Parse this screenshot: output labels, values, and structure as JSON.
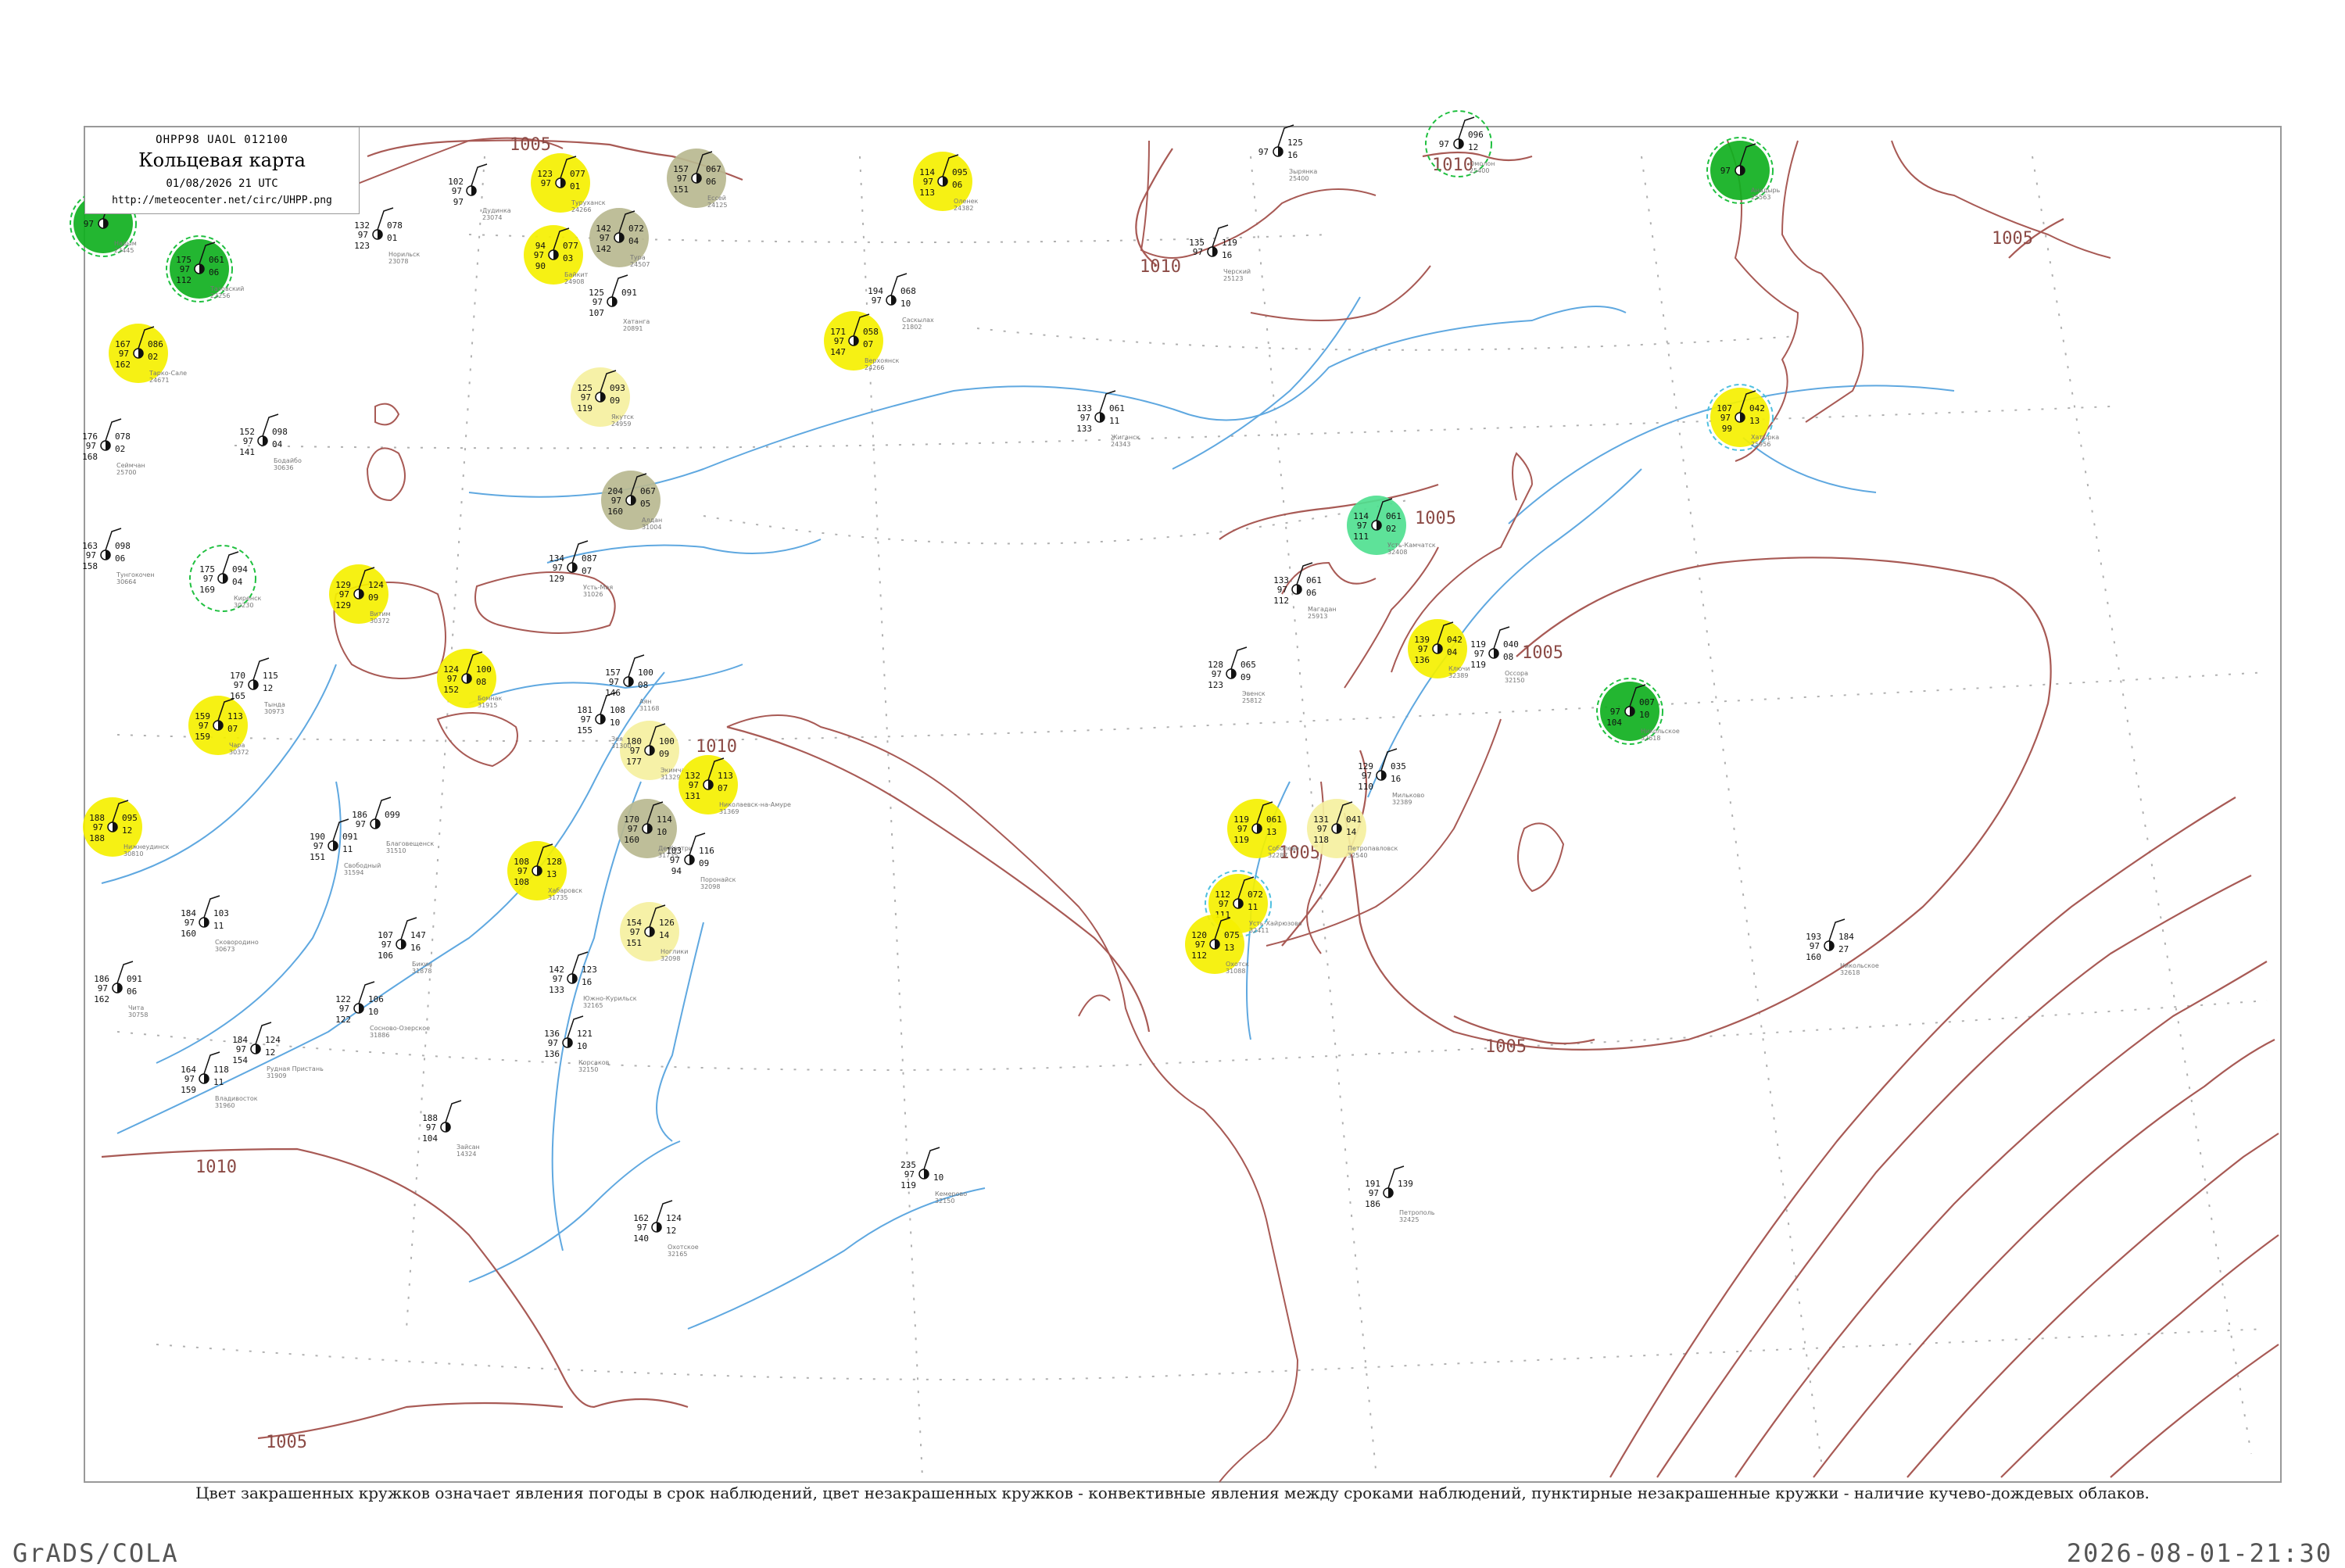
{
  "header": {
    "code": "ОНРР98 UAOL 012100",
    "title": "Кольцевая карта",
    "datetime": "01/08/2026 21 UTC",
    "url": "http://meteocenter.net/circ/UHPP.png"
  },
  "caption": "Цвет закрашенных кружков означает явления погоды в срок наблюдений, цвет незакрашенных кружков - конвективные явления между сроками наблюдений, пунктирные незакрашенные кружки - наличие кучево-дождевых облаков.",
  "footer": {
    "left": "GrADS/COLA",
    "right": "2026-08-01-21:30"
  },
  "colors": {
    "isobar": "#a85a55",
    "river": "#5fa8e0",
    "grid": "#b0b0b0",
    "rain_yellow": "#f5f000",
    "light_yellow": "#f5f0a0",
    "fog_olive": "#b8b890",
    "storm_green": "#10b020",
    "shower_teal": "#50e090",
    "cb_dash": "#20c040"
  },
  "isobar_labels": [
    "1005",
    "1010",
    "1005",
    "1010",
    "1005",
    "1005",
    "1005",
    "1005",
    "1010",
    "1010",
    "1005"
  ],
  "stations": [
    {
      "name": "Надым",
      "id": "23445",
      "tl": "",
      "tr": "",
      "bl": "",
      "br": "",
      "fill": "#10b020",
      "ring": "#20c040",
      "mx": 0.044,
      "my": 0.143
    },
    {
      "name": "Тазовский",
      "id": "23256",
      "tl": "175",
      "tr": "061",
      "bl": "112",
      "br": "06",
      "fill": "#10b020",
      "ring": "#20c040",
      "mx": 0.085,
      "my": 0.172
    },
    {
      "name": "Тарко-Сале",
      "id": "24671",
      "tl": "167",
      "tr": "086",
      "bl": "162",
      "br": "02",
      "fill": "#f5f000",
      "ring": "",
      "mx": 0.059,
      "my": 0.226
    },
    {
      "name": "Туруханск",
      "id": "24266",
      "tl": "123",
      "tr": "077",
      "bl": "",
      "br": "01",
      "fill": "#f5f000",
      "ring": "",
      "mx": 0.239,
      "my": 0.117
    },
    {
      "name": "Ессей",
      "id": "24125",
      "tl": "157",
      "tr": "067",
      "bl": "151",
      "br": "06",
      "fill": "#b8b890",
      "ring": "",
      "mx": 0.297,
      "my": 0.114
    },
    {
      "name": "Тура",
      "id": "24507",
      "tl": "142",
      "tr": "072",
      "bl": "142",
      "br": "04",
      "fill": "#b8b890",
      "ring": "",
      "mx": 0.264,
      "my": 0.152
    },
    {
      "name": "Байкит",
      "id": "24908",
      "tl": "94",
      "tr": "077",
      "bl": "90",
      "br": "03",
      "fill": "#f5f000",
      "ring": "",
      "mx": 0.236,
      "my": 0.163
    },
    {
      "name": "Оленек",
      "id": "24382",
      "tl": "114",
      "tr": "095",
      "bl": "113",
      "br": "06",
      "fill": "#f5f000",
      "ring": "",
      "mx": 0.402,
      "my": 0.116
    },
    {
      "name": "Верхоянск",
      "id": "24266",
      "tl": "171",
      "tr": "058",
      "bl": "147",
      "br": "07",
      "fill": "#f5f000",
      "ring": "",
      "mx": 0.364,
      "my": 0.218
    },
    {
      "name": "Якутск",
      "id": "24959",
      "tl": "125",
      "tr": "093",
      "bl": "119",
      "br": "09",
      "fill": "#f5f0a0",
      "ring": "",
      "mx": 0.256,
      "my": 0.254
    },
    {
      "name": "Алдан",
      "id": "31004",
      "tl": "204",
      "tr": "067",
      "bl": "160",
      "br": "05",
      "fill": "#b8b890",
      "ring": "",
      "mx": 0.269,
      "my": 0.32
    },
    {
      "name": "Омолон",
      "id": "25400",
      "tl": "",
      "tr": "096",
      "bl": "",
      "br": "12",
      "fill": "none",
      "ring": "#20c040",
      "mx": 0.622,
      "my": 0.092
    },
    {
      "name": "Анадырь",
      "id": "25563",
      "tl": "",
      "tr": "",
      "bl": "",
      "br": "",
      "fill": "#10b020",
      "ring": "#20c040",
      "mx": 0.742,
      "my": 0.109
    },
    {
      "name": "Хатырка",
      "id": "25956",
      "tl": "107",
      "tr": "042",
      "bl": "99",
      "br": "13",
      "fill": "#f5f000",
      "ring": "#50c0e0",
      "mx": 0.742,
      "my": 0.267
    },
    {
      "name": "Усть-Камчатск",
      "id": "32408",
      "tl": "114",
      "tr": "061",
      "bl": "111",
      "br": "02",
      "fill": "#50e090",
      "ring": "",
      "mx": 0.587,
      "my": 0.336
    },
    {
      "name": "Ключи",
      "id": "32389",
      "tl": "139",
      "tr": "042",
      "bl": "136",
      "br": "04",
      "fill": "#f5f000",
      "ring": "",
      "mx": 0.613,
      "my": 0.415
    },
    {
      "name": "Никольское",
      "id": "32618",
      "tl": "",
      "tr": "007",
      "bl": "104",
      "br": "10",
      "fill": "#10b020",
      "ring": "#20c040",
      "mx": 0.695,
      "my": 0.455
    },
    {
      "name": "Соболево",
      "id": "32287",
      "tl": "119",
      "tr": "061",
      "bl": "119",
      "br": "13",
      "fill": "#f5f000",
      "ring": "",
      "mx": 0.536,
      "my": 0.53
    },
    {
      "name": "Петропавловск",
      "id": "32540",
      "tl": "131",
      "tr": "041",
      "bl": "118",
      "br": "14",
      "fill": "#f5f0a0",
      "ring": "",
      "mx": 0.57,
      "my": 0.53
    },
    {
      "name": "Усть-Хайрюзово",
      "id": "32411",
      "tl": "112",
      "tr": "072",
      "bl": "111",
      "br": "11",
      "fill": "#f5f000",
      "ring": "#50c0e0",
      "mx": 0.528,
      "my": 0.578
    },
    {
      "name": "Охотск",
      "id": "31088",
      "tl": "120",
      "tr": "075",
      "bl": "112",
      "br": "13",
      "fill": "#f5f000",
      "ring": "",
      "mx": 0.518,
      "my": 0.604
    },
    {
      "name": "Киренск",
      "id": "30230",
      "tl": "175",
      "tr": "094",
      "bl": "169",
      "br": "04",
      "fill": "none",
      "ring": "#20c040",
      "mx": 0.095,
      "my": 0.37
    },
    {
      "name": "Витим",
      "id": "30372",
      "tl": "129",
      "tr": "124",
      "bl": "129",
      "br": "09",
      "fill": "#f5f000",
      "ring": "",
      "mx": 0.153,
      "my": 0.38
    },
    {
      "name": "Бомнак",
      "id": "31915",
      "tl": "124",
      "tr": "100",
      "bl": "152",
      "br": "08",
      "fill": "#f5f000",
      "ring": "",
      "mx": 0.199,
      "my": 0.434
    },
    {
      "name": "Чара",
      "id": "30372",
      "tl": "159",
      "tr": "113",
      "bl": "159",
      "br": "07",
      "fill": "#f5f000",
      "ring": "",
      "mx": 0.093,
      "my": 0.464
    },
    {
      "name": "Нижнеудинск",
      "id": "30810",
      "tl": "188",
      "tr": "095",
      "bl": "188",
      "br": "12",
      "fill": "#f5f000",
      "ring": "",
      "mx": 0.048,
      "my": 0.529
    },
    {
      "name": "Экимчан",
      "id": "31329",
      "tl": "180",
      "tr": "100",
      "bl": "177",
      "br": "09",
      "fill": "#f5f0a0",
      "ring": "",
      "mx": 0.277,
      "my": 0.48
    },
    {
      "name": "Николаевск-на-Амуре",
      "id": "31369",
      "tl": "132",
      "tr": "113",
      "bl": "131",
      "br": "07",
      "fill": "#f5f000",
      "ring": "",
      "mx": 0.302,
      "my": 0.502
    },
    {
      "name": "Де-Кастри",
      "id": "31735",
      "tl": "170",
      "tr": "114",
      "bl": "160",
      "br": "10",
      "fill": "#b8b890",
      "ring": "",
      "mx": 0.276,
      "my": 0.53
    },
    {
      "name": "Хабаровск",
      "id": "31735",
      "tl": "108",
      "tr": "128",
      "bl": "108",
      "br": "13",
      "fill": "#f5f000",
      "ring": "",
      "mx": 0.229,
      "my": 0.557
    },
    {
      "name": "Ноглики",
      "id": "32098",
      "tl": "154",
      "tr": "126",
      "bl": "151",
      "br": "14",
      "fill": "#f5f0a0",
      "ring": "",
      "mx": 0.277,
      "my": 0.596
    }
  ],
  "plain_stations": [
    {
      "name": "Дудинка",
      "id": "23074",
      "tl": "102",
      "tr": "",
      "bl": "97",
      "br": "",
      "mx": 0.201,
      "my": 0.122
    },
    {
      "name": "Норильск",
      "id": "23078",
      "tl": "132",
      "tr": "078",
      "bl": "123",
      "br": "01",
      "mx": 0.161,
      "my": 0.15
    },
    {
      "name": "Хатанга",
      "id": "20891",
      "tl": "125",
      "tr": "091",
      "bl": "107",
      "br": "",
      "mx": 0.261,
      "my": 0.193
    },
    {
      "name": "Саскылах",
      "id": "21802",
      "tl": "194",
      "tr": "068",
      "bl": "",
      "br": "10",
      "mx": 0.38,
      "my": 0.192
    },
    {
      "name": "Жиганск",
      "id": "24343",
      "tl": "133",
      "tr": "061",
      "bl": "133",
      "br": "11",
      "mx": 0.469,
      "my": 0.267
    },
    {
      "name": "Черский",
      "id": "25123",
      "tl": "135",
      "tr": "119",
      "bl": "",
      "br": "16",
      "mx": 0.517,
      "my": 0.161
    },
    {
      "name": "Зырянка",
      "id": "25400",
      "tl": "",
      "tr": "125",
      "bl": "",
      "br": "16",
      "mx": 0.545,
      "my": 0.097
    },
    {
      "name": "Сеймчан",
      "id": "25700",
      "tl": "176",
      "tr": "078",
      "bl": "168",
      "br": "02",
      "mx": 0.045,
      "my": 0.285
    },
    {
      "name": "Бодайбо",
      "id": "30636",
      "tl": "152",
      "tr": "098",
      "bl": "141",
      "br": "04",
      "mx": 0.112,
      "my": 0.282
    },
    {
      "name": "Тунгокочен",
      "id": "30664",
      "tl": "163",
      "tr": "098",
      "bl": "158",
      "br": "06",
      "mx": 0.045,
      "my": 0.355
    },
    {
      "name": "Усть-Мая",
      "id": "31026",
      "tl": "134",
      "tr": "087",
      "bl": "129",
      "br": "07",
      "mx": 0.244,
      "my": 0.363
    },
    {
      "name": "Магадан",
      "id": "25913",
      "tl": "133",
      "tr": "061",
      "bl": "112",
      "br": "06",
      "mx": 0.553,
      "my": 0.377
    },
    {
      "name": "Эвенск",
      "id": "25812",
      "tl": "128",
      "tr": "065",
      "bl": "123",
      "br": "09",
      "mx": 0.525,
      "my": 0.431
    },
    {
      "name": "Оссора",
      "id": "32150",
      "tl": "119",
      "tr": "040",
      "bl": "119",
      "br": "08",
      "mx": 0.637,
      "my": 0.418
    },
    {
      "name": "Мильково",
      "id": "32389",
      "tl": "129",
      "tr": "035",
      "bl": "110",
      "br": "16",
      "mx": 0.589,
      "my": 0.496
    },
    {
      "name": "Аян",
      "id": "31168",
      "tl": "157",
      "tr": "100",
      "bl": "146",
      "br": "08",
      "mx": 0.268,
      "my": 0.436
    },
    {
      "name": "Зея",
      "id": "31300",
      "tl": "181",
      "tr": "108",
      "bl": "155",
      "br": "10",
      "mx": 0.256,
      "my": 0.46
    },
    {
      "name": "Тында",
      "id": "30973",
      "tl": "170",
      "tr": "115",
      "bl": "165",
      "br": "12",
      "mx": 0.108,
      "my": 0.438
    },
    {
      "name": "Благовещенск",
      "id": "31510",
      "tl": "186",
      "tr": "099",
      "bl": "",
      "br": "",
      "mx": 0.16,
      "my": 0.527
    },
    {
      "name": "Свободный",
      "id": "31594",
      "tl": "190",
      "tr": "091",
      "bl": "151",
      "br": "11",
      "mx": 0.142,
      "my": 0.541
    },
    {
      "name": "Поронайск",
      "id": "32098",
      "tl": "103",
      "tr": "116",
      "bl": "94",
      "br": "09",
      "mx": 0.294,
      "my": 0.55
    },
    {
      "name": "Бикин",
      "id": "31878",
      "tl": "107",
      "tr": "147",
      "bl": "106",
      "br": "16",
      "mx": 0.171,
      "my": 0.604
    },
    {
      "name": "Сковородино",
      "id": "30673",
      "tl": "184",
      "tr": "103",
      "bl": "160",
      "br": "11",
      "mx": 0.087,
      "my": 0.59
    },
    {
      "name": "Чита",
      "id": "30758",
      "tl": "186",
      "tr": "091",
      "bl": "162",
      "br": "06",
      "mx": 0.05,
      "my": 0.632
    },
    {
      "name": "Южно-Курильск",
      "id": "32165",
      "tl": "142",
      "tr": "123",
      "bl": "133",
      "br": "16",
      "mx": 0.244,
      "my": 0.626
    },
    {
      "name": "Корсаков",
      "id": "32150",
      "tl": "136",
      "tr": "121",
      "bl": "136",
      "br": "10",
      "mx": 0.242,
      "my": 0.667
    },
    {
      "name": "Владивосток",
      "id": "31960",
      "tl": "164",
      "tr": "118",
      "bl": "159",
      "br": "11",
      "mx": 0.087,
      "my": 0.69
    },
    {
      "name": "Рудная Пристань",
      "id": "31909",
      "tl": "184",
      "tr": "124",
      "bl": "154",
      "br": "12",
      "mx": 0.109,
      "my": 0.671
    },
    {
      "name": "Сосново-Озерское",
      "id": "31886",
      "tl": "122",
      "tr": "106",
      "bl": "122",
      "br": "10",
      "mx": 0.153,
      "my": 0.645
    },
    {
      "name": "Зайсан",
      "id": "14324",
      "tl": "188",
      "tr": "",
      "bl": "104",
      "br": "",
      "mx": 0.19,
      "my": 0.721
    },
    {
      "name": "Кемерово",
      "id": "32150",
      "tl": "235",
      "tr": "",
      "bl": "119",
      "br": "10",
      "mx": 0.394,
      "my": 0.751
    },
    {
      "name": "Охотское",
      "id": "32165",
      "tl": "162",
      "tr": "124",
      "bl": "140",
      "br": "12",
      "mx": 0.28,
      "my": 0.785
    },
    {
      "name": "Никольское",
      "id": "32618",
      "tl": "193",
      "tr": "184",
      "bl": "160",
      "br": "27",
      "mx": 0.78,
      "my": 0.605
    },
    {
      "name": "Петрополь",
      "id": "32425",
      "tl": "191",
      "tr": "139",
      "bl": "186",
      "br": "",
      "mx": 0.592,
      "my": 0.763
    }
  ]
}
